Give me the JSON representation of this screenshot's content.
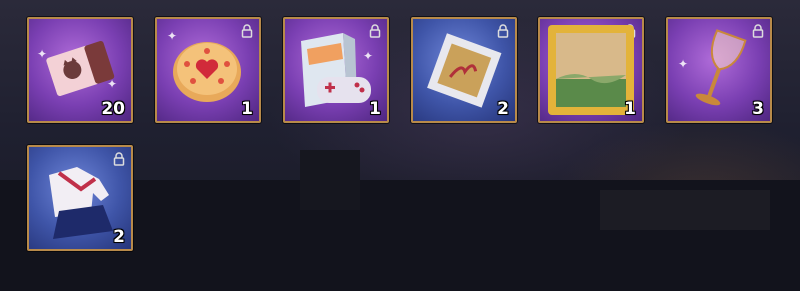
{
  "inventory": {
    "items": [
      {
        "name": "cat-cafe-ticket",
        "quantity": "20",
        "rarity": "purple",
        "locked": false
      },
      {
        "name": "heart-jam-cookie",
        "quantity": "1",
        "rarity": "purple",
        "locked": true
      },
      {
        "name": "game-console-box",
        "quantity": "1",
        "rarity": "purple",
        "locked": true
      },
      {
        "name": "framed-painting-small",
        "quantity": "2",
        "rarity": "blue",
        "locked": true
      },
      {
        "name": "gold-framed-painting",
        "quantity": "1",
        "rarity": "purple",
        "locked": true
      },
      {
        "name": "wine-glass",
        "quantity": "3",
        "rarity": "purple",
        "locked": true
      },
      {
        "name": "sailor-uniform",
        "quantity": "2",
        "rarity": "blue",
        "locked": true
      }
    ]
  },
  "colors": {
    "slot_border": "#b88a4a",
    "rarity_purple": "#7a3fb2",
    "rarity_blue": "#3f55a8"
  }
}
